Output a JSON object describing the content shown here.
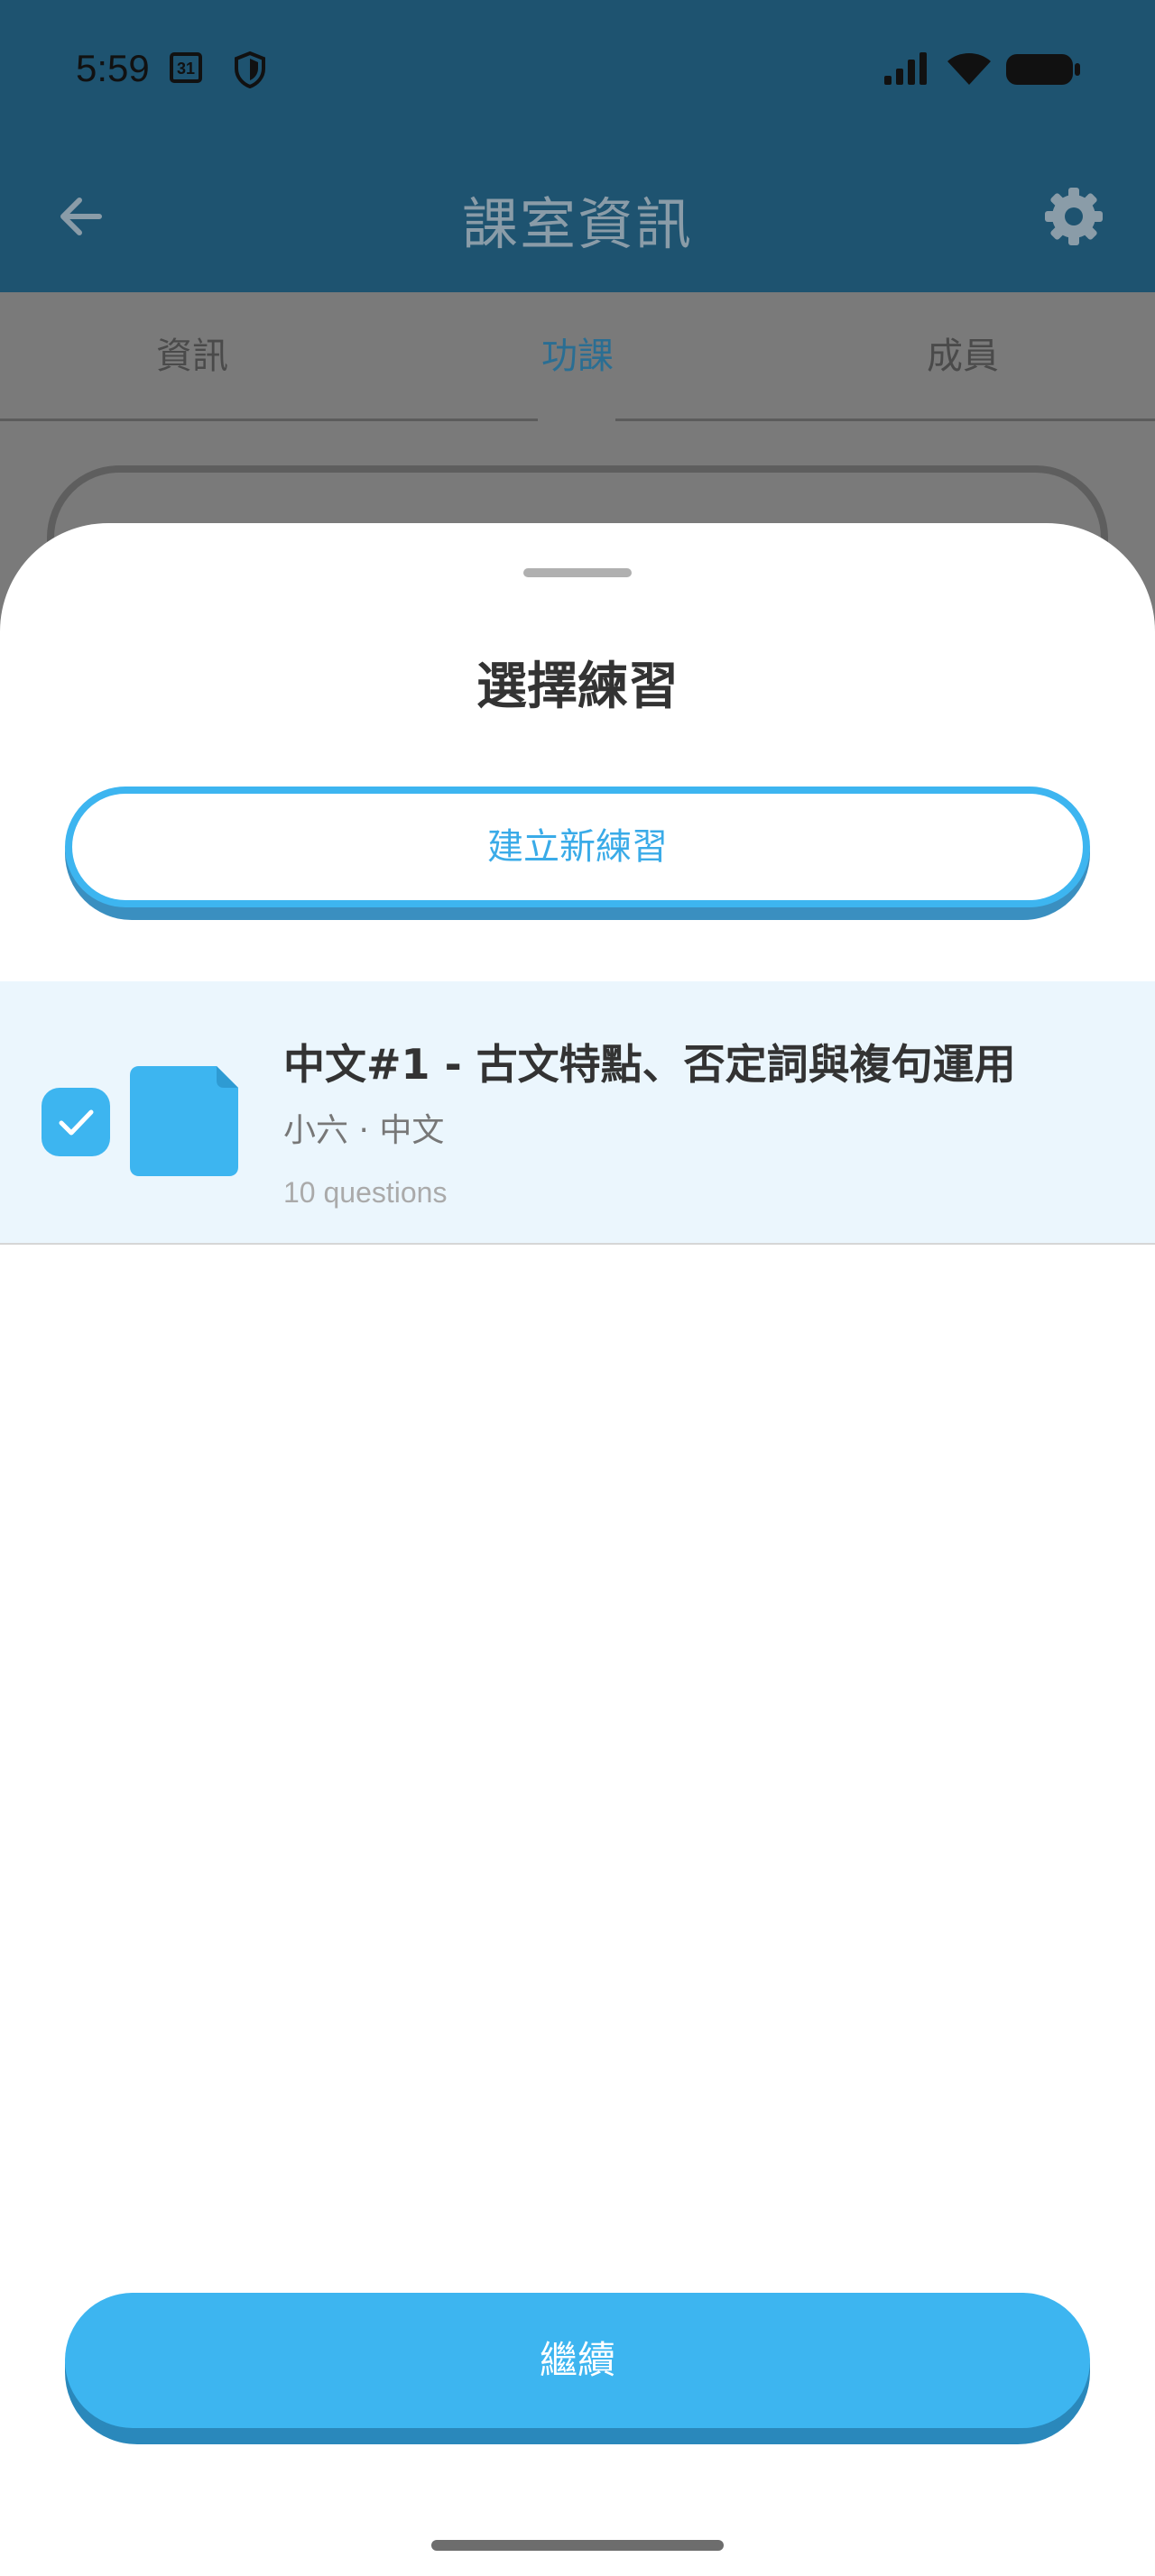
{
  "status_bar": {
    "time": "5:59",
    "calendar_day": "31",
    "icons": [
      "calendar-icon",
      "shield-icon",
      "signal-icon",
      "wifi-icon",
      "battery-icon"
    ]
  },
  "app_bar": {
    "title": "課室資訊",
    "icons": [
      "back-arrow-icon",
      "gear-icon"
    ]
  },
  "tabs": [
    {
      "label": "資訊",
      "active": false
    },
    {
      "label": "功課",
      "active": true
    },
    {
      "label": "成員",
      "active": false
    }
  ],
  "sheet": {
    "title": "選擇練習",
    "create_label": "建立新練習",
    "exercises": [
      {
        "title": "中文#1 - 古文特點、否定詞與複句運用",
        "meta": "小六 · 中文",
        "count": "10 questions",
        "selected": true
      }
    ],
    "continue_label": "繼續"
  },
  "colors": {
    "primary": "#3db5f0",
    "header": "#1e5370",
    "selected_row": "#ebf6fd"
  }
}
